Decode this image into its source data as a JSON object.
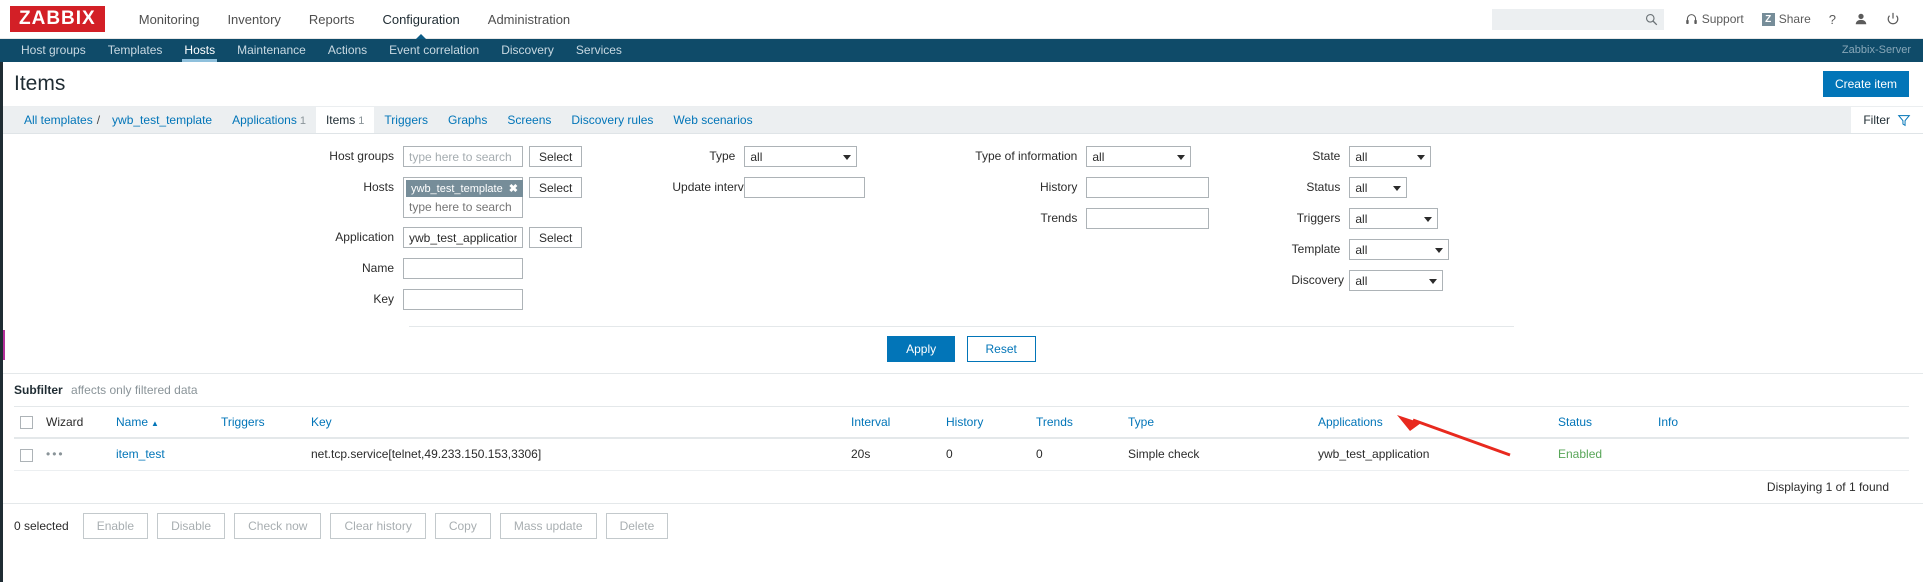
{
  "header": {
    "logo": "ZABBIX",
    "nav": [
      {
        "label": "Monitoring",
        "selected": false
      },
      {
        "label": "Inventory",
        "selected": false
      },
      {
        "label": "Reports",
        "selected": false
      },
      {
        "label": "Configuration",
        "selected": true
      },
      {
        "label": "Administration",
        "selected": false
      }
    ],
    "search_value": "",
    "search_placeholder": "",
    "support_label": "Support",
    "share_label": "Share",
    "share_badge": "Z",
    "help_label": "?",
    "user_icon": "user-icon",
    "signout_icon": "power-icon"
  },
  "subnav": {
    "items": [
      {
        "label": "Host groups",
        "selected": false
      },
      {
        "label": "Templates",
        "selected": false
      },
      {
        "label": "Hosts",
        "selected": true
      },
      {
        "label": "Maintenance",
        "selected": false
      },
      {
        "label": "Actions",
        "selected": false
      },
      {
        "label": "Event correlation",
        "selected": false
      },
      {
        "label": "Discovery",
        "selected": false
      },
      {
        "label": "Services",
        "selected": false
      }
    ],
    "server": "Zabbix-Server"
  },
  "title": {
    "text": "Items",
    "create_button": "Create item"
  },
  "breadcrumb": {
    "root": "All templates",
    "separator": "/",
    "template": "ywb_test_template",
    "tabs": [
      {
        "label": "Applications",
        "count": "1",
        "active": false
      },
      {
        "label": "Items",
        "count": "1",
        "active": true
      },
      {
        "label": "Triggers",
        "count": "",
        "active": false
      },
      {
        "label": "Graphs",
        "count": "",
        "active": false
      },
      {
        "label": "Screens",
        "count": "",
        "active": false
      },
      {
        "label": "Discovery rules",
        "count": "",
        "active": false
      },
      {
        "label": "Web scenarios",
        "count": "",
        "active": false
      }
    ],
    "filter_toggle": "Filter"
  },
  "filter": {
    "col1": [
      {
        "label": "Host groups",
        "type": "search-select",
        "value": "",
        "placeholder": "type here to search",
        "button": "Select"
      },
      {
        "label": "Hosts",
        "type": "multiselect",
        "chip": "ywb_test_template",
        "placeholder": "type here to search",
        "button": "Select"
      },
      {
        "label": "Application",
        "type": "text-select",
        "value": "ywb_test_application",
        "placeholder": "",
        "button": "Select"
      },
      {
        "label": "Name",
        "type": "text",
        "value": "",
        "placeholder": ""
      },
      {
        "label": "Key",
        "type": "text",
        "value": "",
        "placeholder": ""
      }
    ],
    "col2": [
      {
        "label": "Type",
        "type": "select",
        "value": "all"
      },
      {
        "label": "Update interval",
        "type": "text",
        "value": ""
      }
    ],
    "col3": [
      {
        "label": "Type of information",
        "type": "select",
        "value": "all"
      },
      {
        "label": "History",
        "type": "text",
        "value": ""
      },
      {
        "label": "Trends",
        "type": "text",
        "value": ""
      }
    ],
    "col4": [
      {
        "label": "State",
        "type": "select",
        "value": "all"
      },
      {
        "label": "Status",
        "type": "select",
        "value": "all"
      },
      {
        "label": "Triggers",
        "type": "select",
        "value": "all"
      },
      {
        "label": "Template",
        "type": "select",
        "value": "all"
      },
      {
        "label": "Discovery",
        "type": "select",
        "value": "all"
      }
    ],
    "apply": "Apply",
    "reset": "Reset"
  },
  "subfilter": {
    "title": "Subfilter",
    "desc": "affects only filtered data"
  },
  "table": {
    "columns": [
      "",
      "Wizard",
      "Name",
      "Triggers",
      "Key",
      "Interval",
      "History",
      "Trends",
      "Type",
      "Applications",
      "Status",
      "Info"
    ],
    "sort_column": "Name",
    "sort_dir": "▲",
    "rows": [
      {
        "wizard": "•••",
        "name": "item_test",
        "triggers": "",
        "key": "net.tcp.service[telnet,49.233.150.153,3306]",
        "interval": "20s",
        "history": "0",
        "trends": "0",
        "type": "Simple check",
        "applications": "ywb_test_application",
        "status": "Enabled",
        "info": ""
      }
    ],
    "displaying": "Displaying 1 of 1 found"
  },
  "footer": {
    "selected": "0 selected",
    "buttons": [
      "Enable",
      "Disable",
      "Check now",
      "Clear history",
      "Copy",
      "Mass update",
      "Delete"
    ]
  },
  "colors": {
    "brand_red": "#d31f26",
    "nav_dark": "#0f4b69",
    "accent_blue": "#0275b8",
    "enabled_green": "#59a659",
    "arrow_red": "#e8291e"
  }
}
